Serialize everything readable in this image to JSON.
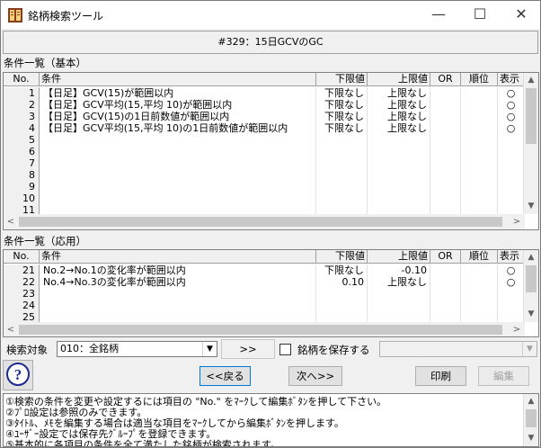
{
  "window": {
    "title": "銘柄検索ツール",
    "minimize_glyph": "—",
    "maximize_glyph": "☐",
    "close_glyph": "✕"
  },
  "caption": "#329：15日GCVのGC",
  "basic": {
    "label": "条件一覧（基本）",
    "headers": {
      "no": "No.",
      "cond": "条件",
      "lo": "下限値",
      "hi": "上限値",
      "or": "OR",
      "rank": "順位",
      "disp": "表示"
    },
    "rows": [
      {
        "no": "1",
        "cond": "【日足】GCV(15)が範囲以内",
        "lo": "下限なし",
        "hi": "上限なし",
        "or": "",
        "rank": "",
        "disp": "○"
      },
      {
        "no": "2",
        "cond": "【日足】GCV平均(15,平均 10)が範囲以内",
        "lo": "下限なし",
        "hi": "上限なし",
        "or": "",
        "rank": "",
        "disp": "○"
      },
      {
        "no": "3",
        "cond": "【日足】GCV(15)の1日前数値が範囲以内",
        "lo": "下限なし",
        "hi": "上限なし",
        "or": "",
        "rank": "",
        "disp": "○"
      },
      {
        "no": "4",
        "cond": "【日足】GCV平均(15,平均 10)の1日前数値が範囲以内",
        "lo": "下限なし",
        "hi": "上限なし",
        "or": "",
        "rank": "",
        "disp": "○"
      },
      {
        "no": "5",
        "cond": "",
        "lo": "",
        "hi": "",
        "or": "",
        "rank": "",
        "disp": ""
      },
      {
        "no": "6",
        "cond": "",
        "lo": "",
        "hi": "",
        "or": "",
        "rank": "",
        "disp": ""
      },
      {
        "no": "7",
        "cond": "",
        "lo": "",
        "hi": "",
        "or": "",
        "rank": "",
        "disp": ""
      },
      {
        "no": "8",
        "cond": "",
        "lo": "",
        "hi": "",
        "or": "",
        "rank": "",
        "disp": ""
      },
      {
        "no": "9",
        "cond": "",
        "lo": "",
        "hi": "",
        "or": "",
        "rank": "",
        "disp": ""
      },
      {
        "no": "10",
        "cond": "",
        "lo": "",
        "hi": "",
        "or": "",
        "rank": "",
        "disp": ""
      },
      {
        "no": "11",
        "cond": "",
        "lo": "",
        "hi": "",
        "or": "",
        "rank": "",
        "disp": ""
      }
    ]
  },
  "applied": {
    "label": "条件一覧（応用）",
    "headers": {
      "no": "No.",
      "cond": "条件",
      "lo": "下限値",
      "hi": "上限値",
      "or": "OR",
      "rank": "順位",
      "disp": "表示"
    },
    "rows": [
      {
        "no": "21",
        "cond": "No.2→No.1の変化率が範囲以内",
        "lo": "下限なし",
        "hi": "-0.10",
        "or": "",
        "rank": "",
        "disp": "○"
      },
      {
        "no": "22",
        "cond": "No.4→No.3の変化率が範囲以内",
        "lo": "0.10",
        "hi": "上限なし",
        "or": "",
        "rank": "",
        "disp": "○"
      },
      {
        "no": "23",
        "cond": "",
        "lo": "",
        "hi": "",
        "or": "",
        "rank": "",
        "disp": ""
      },
      {
        "no": "24",
        "cond": "",
        "lo": "",
        "hi": "",
        "or": "",
        "rank": "",
        "disp": ""
      },
      {
        "no": "25",
        "cond": "",
        "lo": "",
        "hi": "",
        "or": "",
        "rank": "",
        "disp": ""
      }
    ]
  },
  "scroll_glyphs": {
    "up": "▲",
    "down": "▼",
    "left": "<",
    "right": ">"
  },
  "search": {
    "label": "検索対象",
    "target_value": "010：全銘柄",
    "dropdown_glyph": "▼",
    "arrow_button": ">>",
    "save_label": "銘柄を保存する",
    "save_target_value": ""
  },
  "buttons": {
    "help": "?",
    "back": "<<戻る",
    "next": "次へ>>",
    "print": "印刷",
    "edit": "編集"
  },
  "notes": [
    "①検索の条件を変更や設定するには項目の \"No.\" をﾏｰｸして編集ﾎﾞﾀﾝを押して下さい。",
    "②ﾌﾟﾛ設定は参照のみできます。",
    "③ﾀｲﾄﾙ、ﾒﾓを編集する場合は適当な項目をﾏｰｸしてから編集ﾎﾞﾀﾝを押します。",
    "④ﾕｰｻﾞｰ設定では保存先ｸﾞﾙｰﾌﾟを登録できます。",
    "⑤基本的に各項目の条件を全て満たした銘柄が検索されます。"
  ]
}
